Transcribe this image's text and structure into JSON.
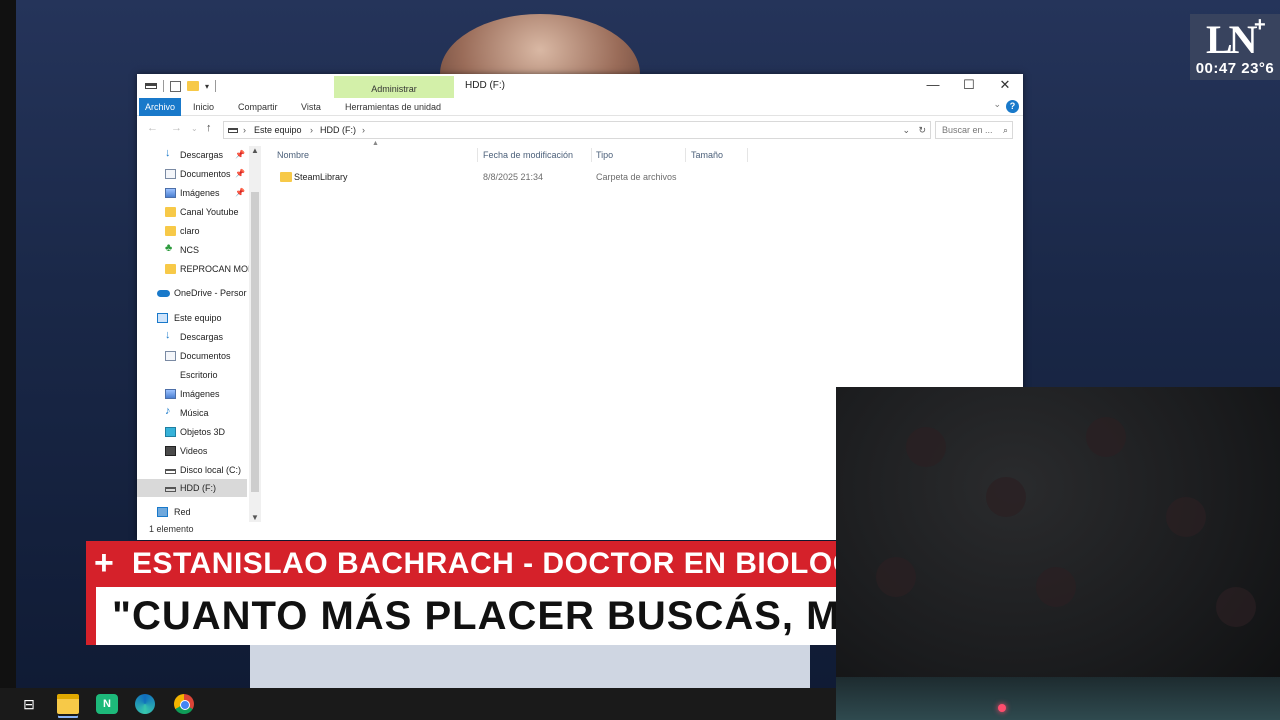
{
  "overlay": {
    "logo": "LN",
    "time": "00:47 23°6"
  },
  "explorer": {
    "context_tab": "Administrar",
    "window_title": "HDD (F:)",
    "window_buttons": {
      "minimize": "—",
      "maximize": "☐",
      "close": "✕"
    },
    "ribbon_tabs": {
      "file": "Archivo",
      "home": "Inicio",
      "share": "Compartir",
      "view": "Vista",
      "drive_tools": "Herramientas de unidad"
    },
    "address": {
      "segments": [
        "Este equipo",
        "HDD (F:)"
      ]
    },
    "search": {
      "placeholder": "Buscar en ..."
    },
    "nav_pane": [
      {
        "label": "Descargas",
        "icon": "download-icon",
        "pinned": true
      },
      {
        "label": "Documentos",
        "icon": "documents-icon",
        "pinned": true
      },
      {
        "label": "Imágenes",
        "icon": "pictures-icon",
        "pinned": true
      },
      {
        "label": "Canal Youtube",
        "icon": "folder-icon",
        "pinned": false
      },
      {
        "label": "claro",
        "icon": "folder-icon",
        "pinned": false
      },
      {
        "label": "NCS",
        "icon": "tree-icon",
        "pinned": false
      },
      {
        "label": "REPROCAN MOI",
        "icon": "folder-icon",
        "pinned": false
      },
      {
        "label": "OneDrive - Persor",
        "icon": "onedrive-icon",
        "pinned": false
      },
      {
        "label": "Este equipo",
        "icon": "this-pc-icon",
        "pinned": false
      },
      {
        "label": "Descargas",
        "icon": "download-icon",
        "pinned": false
      },
      {
        "label": "Documentos",
        "icon": "documents-icon",
        "pinned": false
      },
      {
        "label": "Escritorio",
        "icon": "desktop-icon",
        "pinned": false
      },
      {
        "label": "Imágenes",
        "icon": "pictures-icon",
        "pinned": false
      },
      {
        "label": "Música",
        "icon": "music-icon",
        "pinned": false
      },
      {
        "label": "Objetos 3D",
        "icon": "3d-objects-icon",
        "pinned": false
      },
      {
        "label": "Videos",
        "icon": "videos-icon",
        "pinned": false
      },
      {
        "label": "Disco local (C:)",
        "icon": "drive-icon",
        "pinned": false
      },
      {
        "label": "HDD (F:)",
        "icon": "drive-icon",
        "pinned": false,
        "selected": true
      },
      {
        "label": "Red",
        "icon": "network-icon",
        "pinned": false
      }
    ],
    "columns": {
      "name": "Nombre",
      "modified": "Fecha de modificación",
      "type": "Tipo",
      "size": "Tamaño"
    },
    "files": [
      {
        "name": "SteamLibrary",
        "modified": "8/8/2025 21:34",
        "type": "Carpeta de archivos",
        "size": ""
      }
    ],
    "status": "1 elemento"
  },
  "banner": {
    "line1": "ESTANISLAO BACHRACH - DOCTOR EN BIOLOGÍA MOLI",
    "line2": "\"CUANTO MÁS PLACER BUSCÁS, MÁS IN"
  },
  "taskbar": {
    "store_glyph": "N"
  }
}
